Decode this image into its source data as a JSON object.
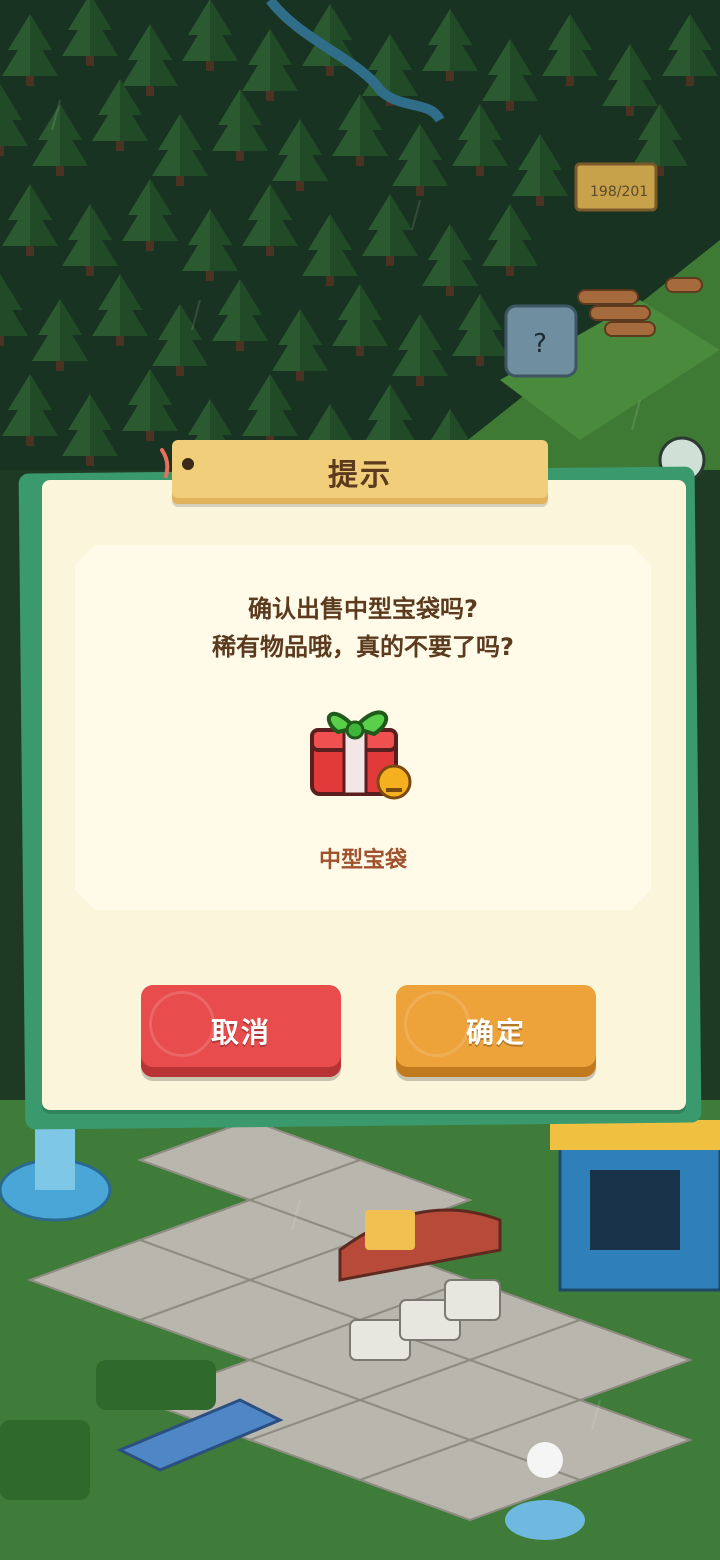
{
  "scene": {
    "counter_text": "198/201"
  },
  "dialog": {
    "title": "提示",
    "message_line1": "确认出售中型宝袋吗?",
    "message_line2": "稀有物品哦，真的不要了吗?",
    "item_name": "中型宝袋",
    "item_icon": "gift-box-icon",
    "cancel_label": "取消",
    "confirm_label": "确定"
  },
  "colors": {
    "cancel": "#e84c4c",
    "confirm": "#eda23a",
    "dialog_bg": "#fbf5dc",
    "title_tag": "#f1ce7a",
    "dialog_border": "#3a9a6e"
  }
}
